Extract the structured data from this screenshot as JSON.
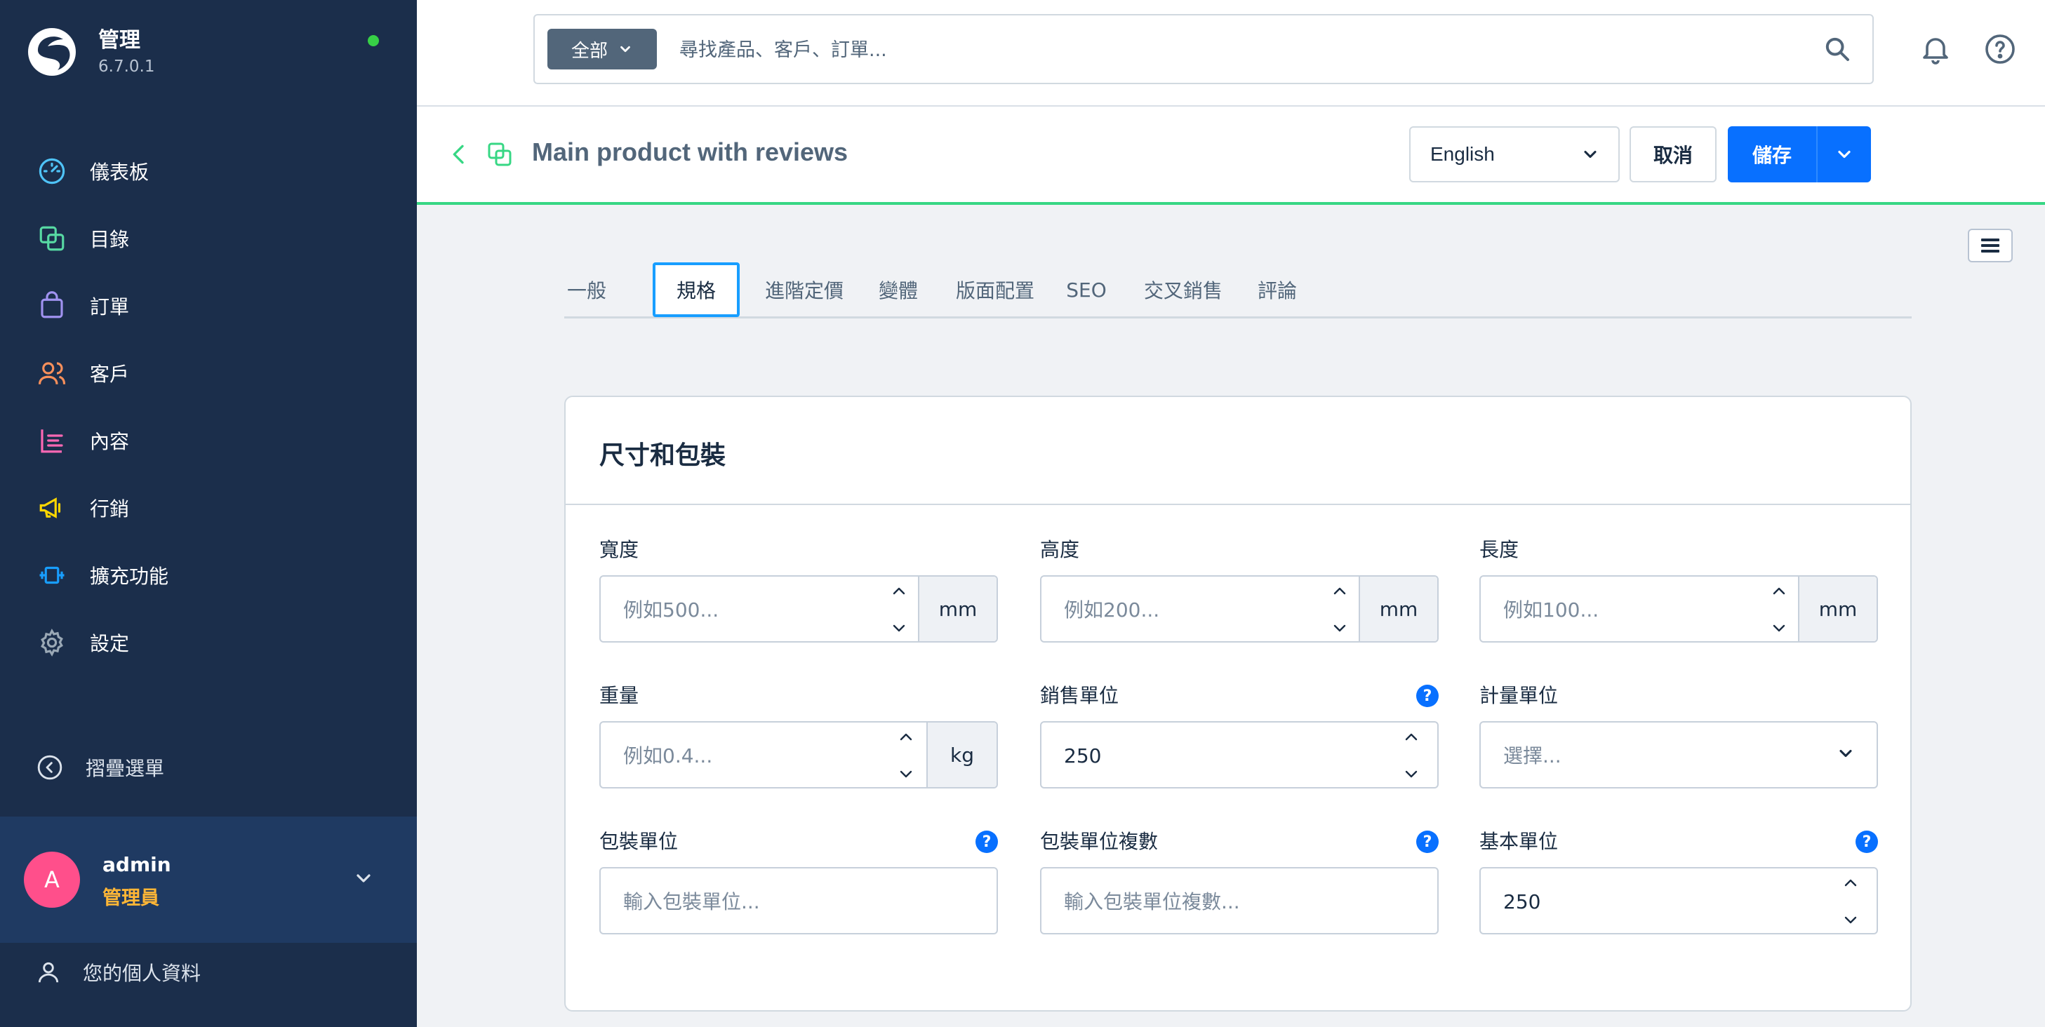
{
  "app": {
    "name": "管理",
    "version": "6.7.0.1",
    "online_color": "#37d046"
  },
  "sidebar": {
    "items": [
      {
        "label": "儀表板",
        "icon": "gauge-icon",
        "color": "#4fc3f7"
      },
      {
        "label": "目錄",
        "icon": "catalog-icon",
        "color": "#57d9a3"
      },
      {
        "label": "訂單",
        "icon": "shopping-bag-icon",
        "color": "#a092f0"
      },
      {
        "label": "客戶",
        "icon": "users-icon",
        "color": "#f9905b"
      },
      {
        "label": "內容",
        "icon": "content-icon",
        "color": "#ff68b4"
      },
      {
        "label": "行銷",
        "icon": "megaphone-icon",
        "color": "#ffd700"
      },
      {
        "label": "擴充功能",
        "icon": "plug-icon",
        "color": "#189eff"
      },
      {
        "label": "設定",
        "icon": "gear-icon",
        "color": "#9aa8b5"
      }
    ],
    "collapse_label": "摺疊選單",
    "user": {
      "initial": "A",
      "name": "admin",
      "role": "管理員"
    },
    "profile_label": "您的個人資料"
  },
  "search": {
    "scope": "全部",
    "placeholder": "尋找產品、客戶、訂單..."
  },
  "header": {
    "title": "Main product with reviews",
    "language": "English",
    "cancel_label": "取消",
    "save_label": "儲存"
  },
  "tabs": [
    "一般",
    "規格",
    "進階定價",
    "變體",
    "版面配置",
    "SEO",
    "交叉銷售",
    "評論"
  ],
  "active_tab": "規格",
  "card": {
    "title": "尺寸和包裝",
    "fields": {
      "width": {
        "label": "寬度",
        "placeholder": "例如500...",
        "unit": "mm"
      },
      "height": {
        "label": "高度",
        "placeholder": "例如200...",
        "unit": "mm"
      },
      "length": {
        "label": "長度",
        "placeholder": "例如100...",
        "unit": "mm"
      },
      "weight": {
        "label": "重量",
        "placeholder": "例如0.4...",
        "unit": "kg"
      },
      "sales_unit": {
        "label": "銷售單位",
        "value": "250",
        "help": "?"
      },
      "measure_unit": {
        "label": "計量單位",
        "placeholder": "選擇..."
      },
      "pack_unit": {
        "label": "包裝單位",
        "placeholder": "輸入包裝單位...",
        "help": "?"
      },
      "pack_unit_plural": {
        "label": "包裝單位複數",
        "placeholder": "輸入包裝單位複數...",
        "help": "?"
      },
      "reference_unit": {
        "label": "基本單位",
        "value": "250",
        "help": "?"
      }
    }
  },
  "colors": {
    "sidebar_bg": "#1b2e4b",
    "accent": "#0870ff",
    "active_tab_border": "#189eff",
    "header_line": "#37d784"
  }
}
